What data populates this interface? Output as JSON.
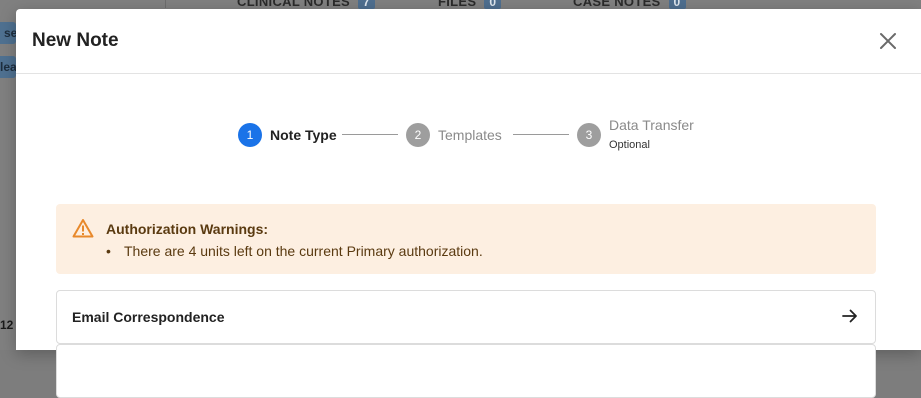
{
  "background": {
    "tabs": [
      {
        "label": "CLINICAL NOTES",
        "count": "7"
      },
      {
        "label": "FILES",
        "count": "0"
      },
      {
        "label": "CASE NOTES",
        "count": "0"
      }
    ],
    "left_chips": [
      "se",
      "lea"
    ],
    "left_number": "12"
  },
  "modal": {
    "title": "New Note",
    "close_icon": "close-icon",
    "steps": [
      {
        "number": "1",
        "label": "Note Type",
        "status": "active"
      },
      {
        "number": "2",
        "label": "Templates",
        "status": "inactive"
      },
      {
        "number": "3",
        "label": "Data Transfer",
        "sublabel": "Optional",
        "status": "inactive"
      }
    ],
    "warning": {
      "icon": "warning-triangle-icon",
      "title": "Authorization Warnings:",
      "items": [
        "There are 4 units left on the current Primary authorization."
      ]
    },
    "options": [
      {
        "label": "Email Correspondence",
        "icon": "arrow-right-icon"
      },
      {
        "label": ""
      }
    ]
  },
  "colors": {
    "accent": "#1a73e8",
    "step_inactive": "#9e9e9e",
    "warning_bg": "#fdefe1",
    "warning_icon": "#e8892b"
  }
}
